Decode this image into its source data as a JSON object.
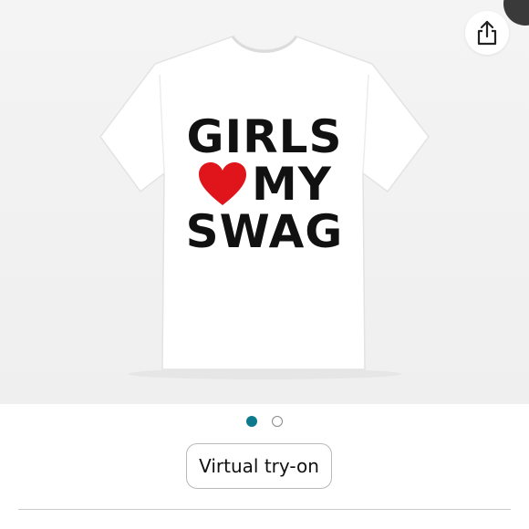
{
  "product_image": {
    "shirt_lines": [
      "GIRLS",
      "MY",
      "SWAG"
    ],
    "heart_color": "#e0151b",
    "shirt_color": "#ffffff",
    "text_color": "#111111"
  },
  "share": {
    "icon": "share-icon"
  },
  "carousel": {
    "total": 2,
    "active_index": 0,
    "active_color": "#0f7a8c"
  },
  "virtual_tryon": {
    "label": "Virtual try-on"
  }
}
